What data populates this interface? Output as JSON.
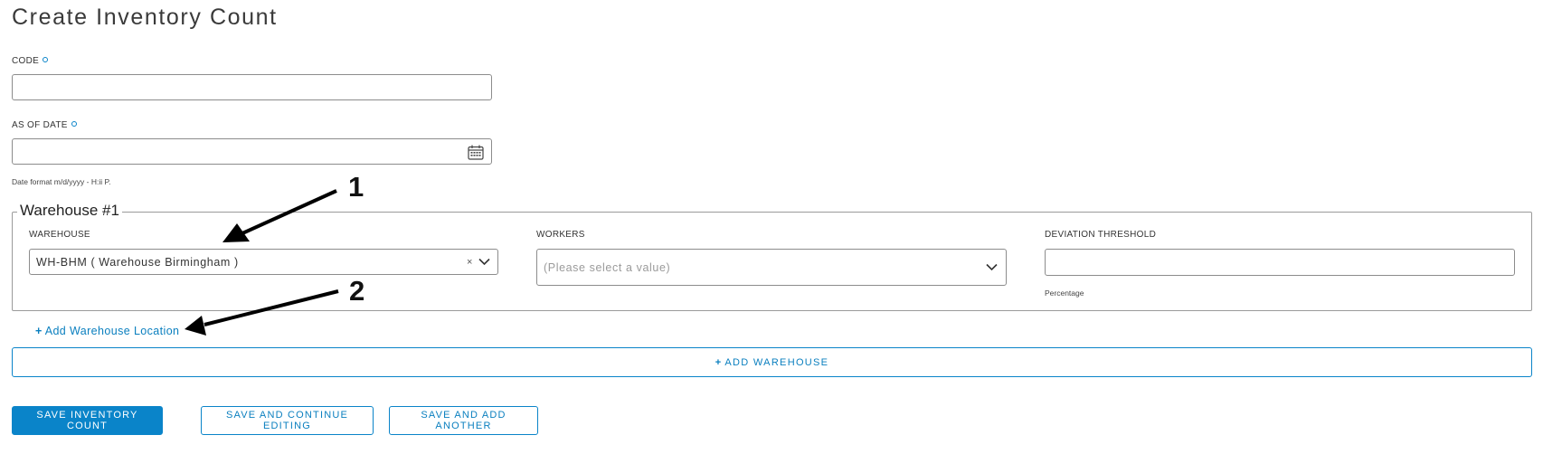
{
  "page": {
    "title": "Create Inventory Count"
  },
  "form": {
    "code": {
      "label": "CODE",
      "value": "",
      "placeholder": ""
    },
    "as_of_date": {
      "label": "AS OF DATE",
      "value": "",
      "placeholder": "",
      "help": "Date format m/d/yyyy - H:ii P."
    },
    "warehouse_group": {
      "legend": "Warehouse #1",
      "warehouse": {
        "label": "WAREHOUSE",
        "value": "WH-BHM ( Warehouse Birmingham )",
        "clear_glyph": "×"
      },
      "workers": {
        "label": "WORKERS",
        "placeholder": "(Please select a value)"
      },
      "deviation_threshold": {
        "label": "DEVIATION THRESHOLD",
        "value": "",
        "help": "Percentage"
      }
    },
    "add_location_label": "Add Warehouse Location",
    "add_warehouse_label": "ADD WAREHOUSE"
  },
  "actions": {
    "save": "SAVE INVENTORY COUNT",
    "save_continue": "SAVE AND CONTINUE EDITING",
    "save_add_another": "SAVE AND ADD ANOTHER"
  },
  "annotations": {
    "arrow_1": "1",
    "arrow_2": "2"
  },
  "icons": [
    "required-dot-icon",
    "calendar-icon",
    "clear-icon",
    "chevron-down-icon",
    "plus-icon",
    "arrow-icon"
  ],
  "colors": {
    "accent": "#0a84c9",
    "link": "#0a7fbf",
    "border": "#8c8c8c"
  }
}
